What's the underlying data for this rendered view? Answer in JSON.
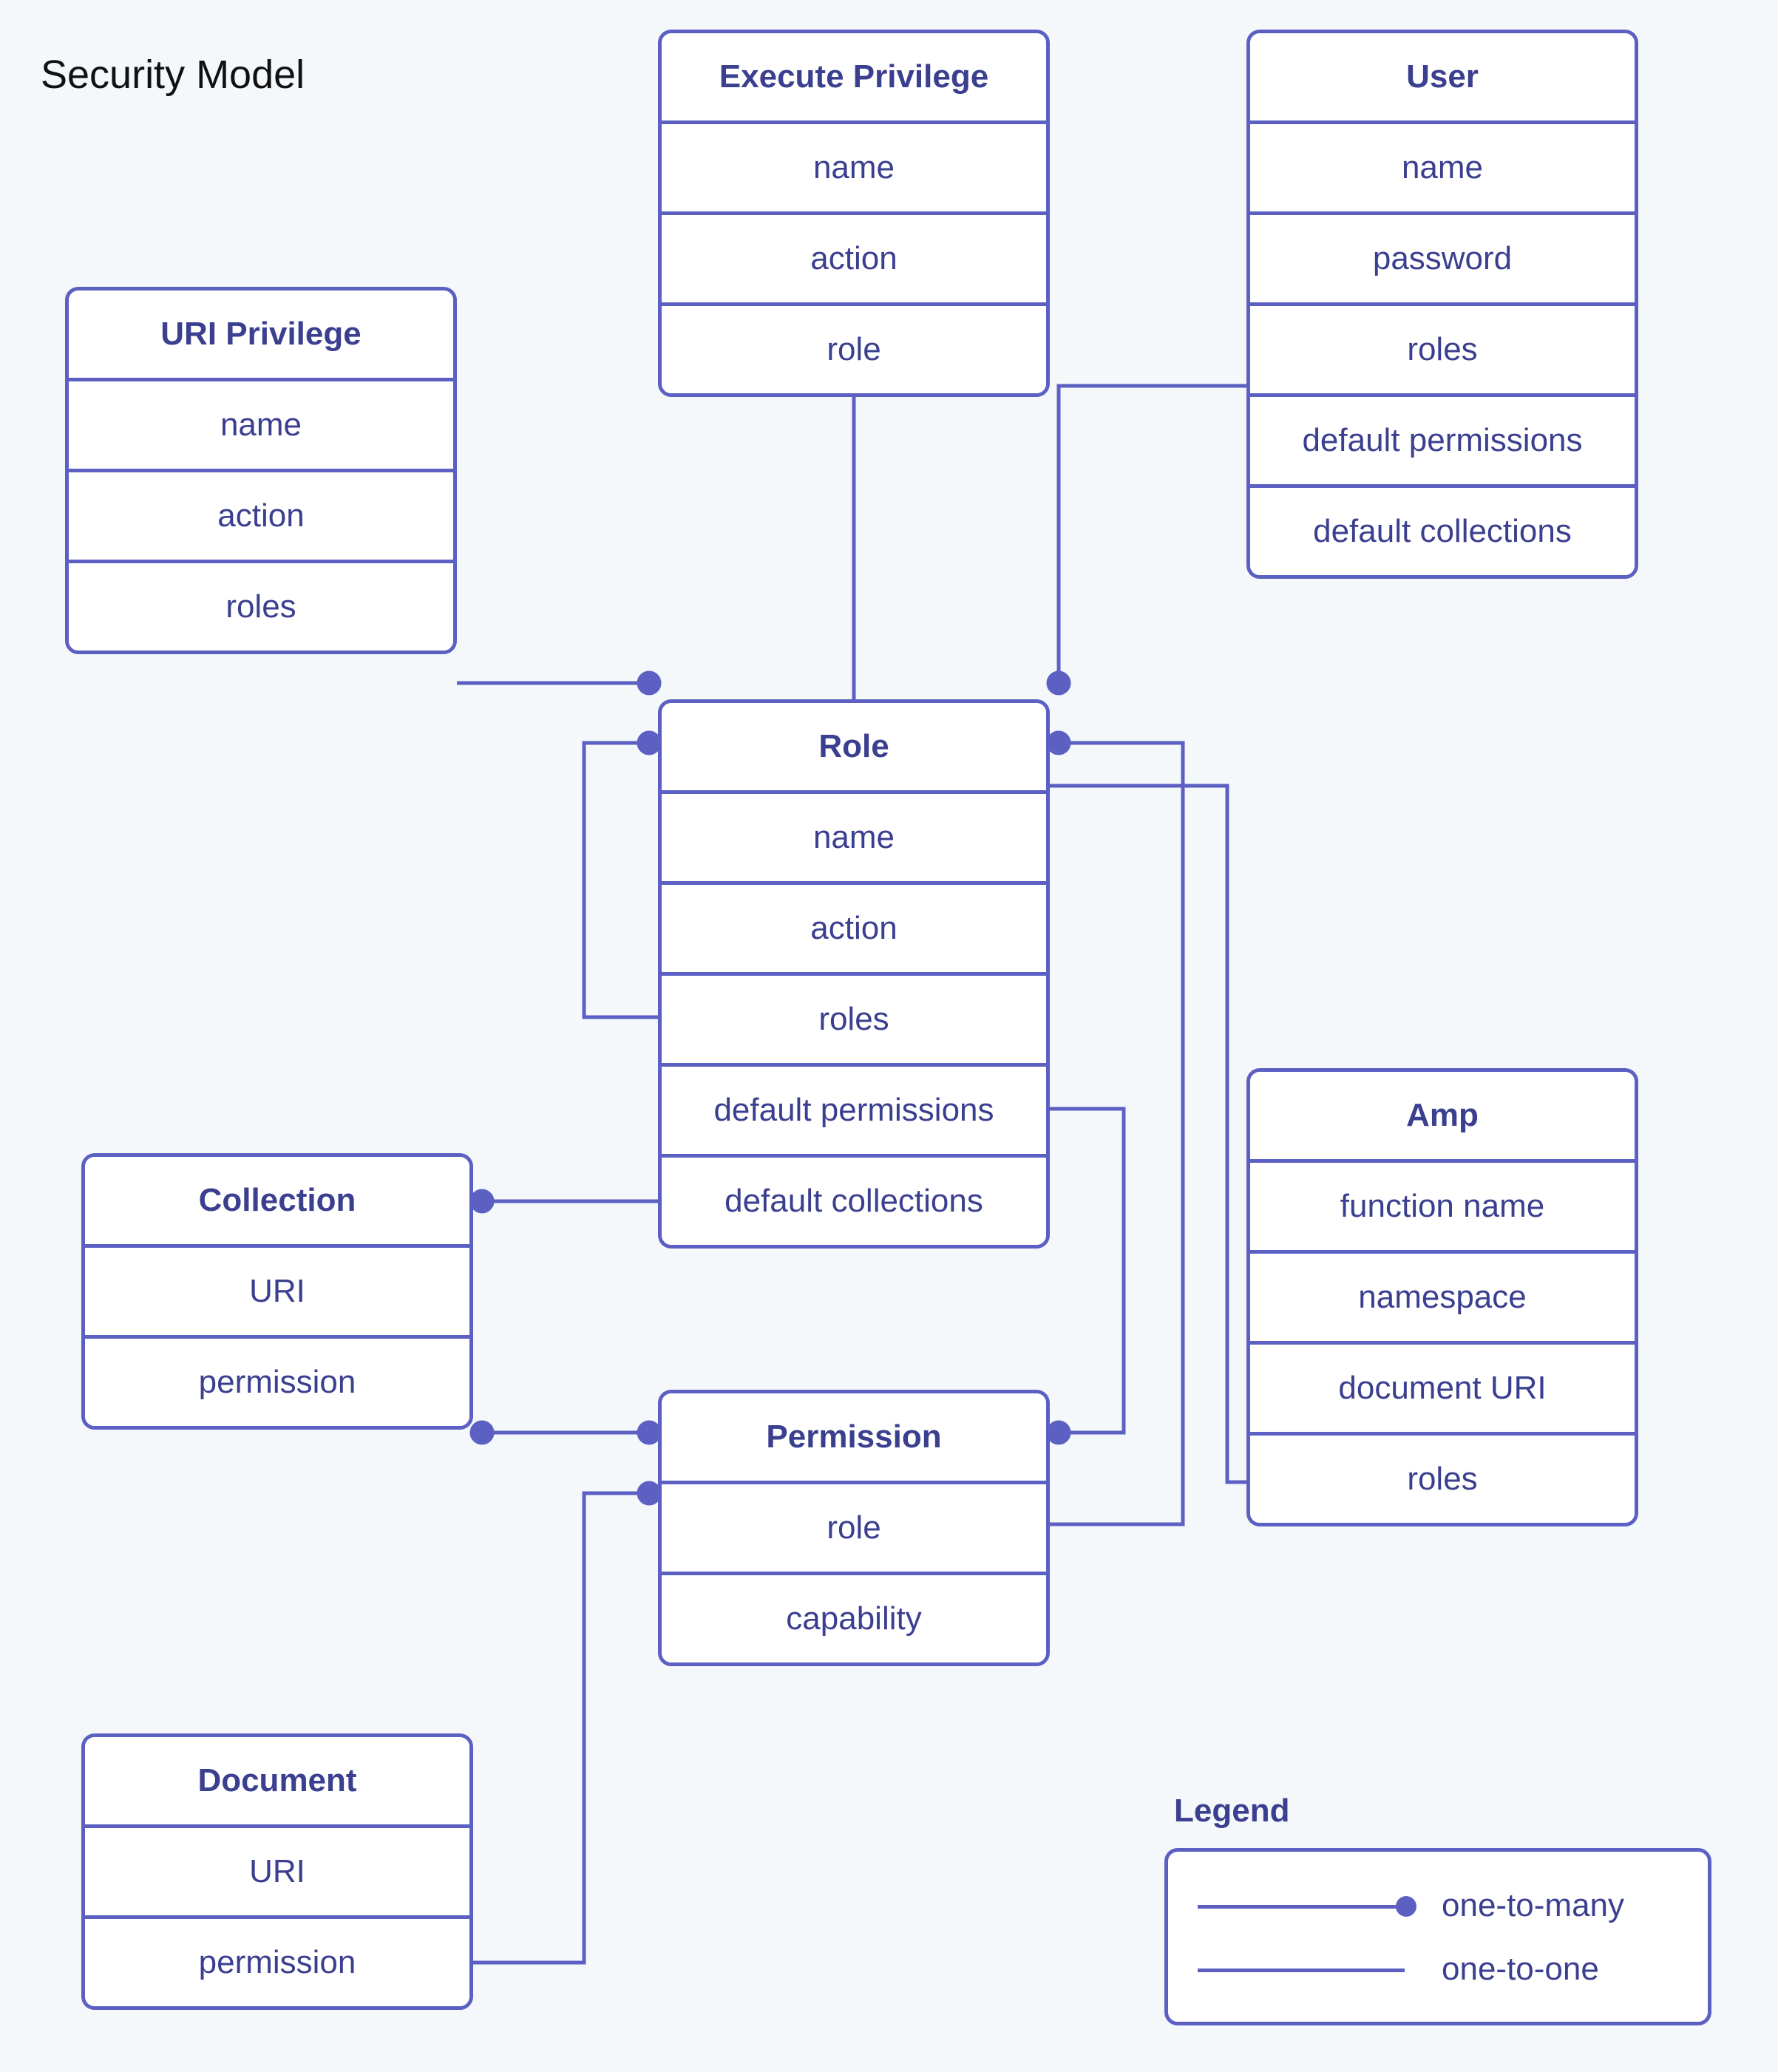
{
  "title": "Security Model",
  "entities": {
    "uri_privilege": {
      "header": "URI Privilege",
      "rows": [
        "name",
        "action",
        "roles"
      ]
    },
    "execute_privilege": {
      "header": "Execute Privilege",
      "rows": [
        "name",
        "action",
        "role"
      ]
    },
    "user": {
      "header": "User",
      "rows": [
        "name",
        "password",
        "roles",
        "default permissions",
        "default collections"
      ]
    },
    "role": {
      "header": "Role",
      "rows": [
        "name",
        "action",
        "roles",
        "default permissions",
        "default collections"
      ]
    },
    "collection": {
      "header": "Collection",
      "rows": [
        "URI",
        "permission"
      ]
    },
    "amp": {
      "header": "Amp",
      "rows": [
        "function name",
        "namespace",
        "document URI",
        "roles"
      ]
    },
    "permission": {
      "header": "Permission",
      "rows": [
        "role",
        "capability"
      ]
    },
    "document": {
      "header": "Document",
      "rows": [
        "URI",
        "permission"
      ]
    }
  },
  "legend": {
    "title": "Legend",
    "one_to_many": "one-to-many",
    "one_to_one": "one-to-one"
  }
}
